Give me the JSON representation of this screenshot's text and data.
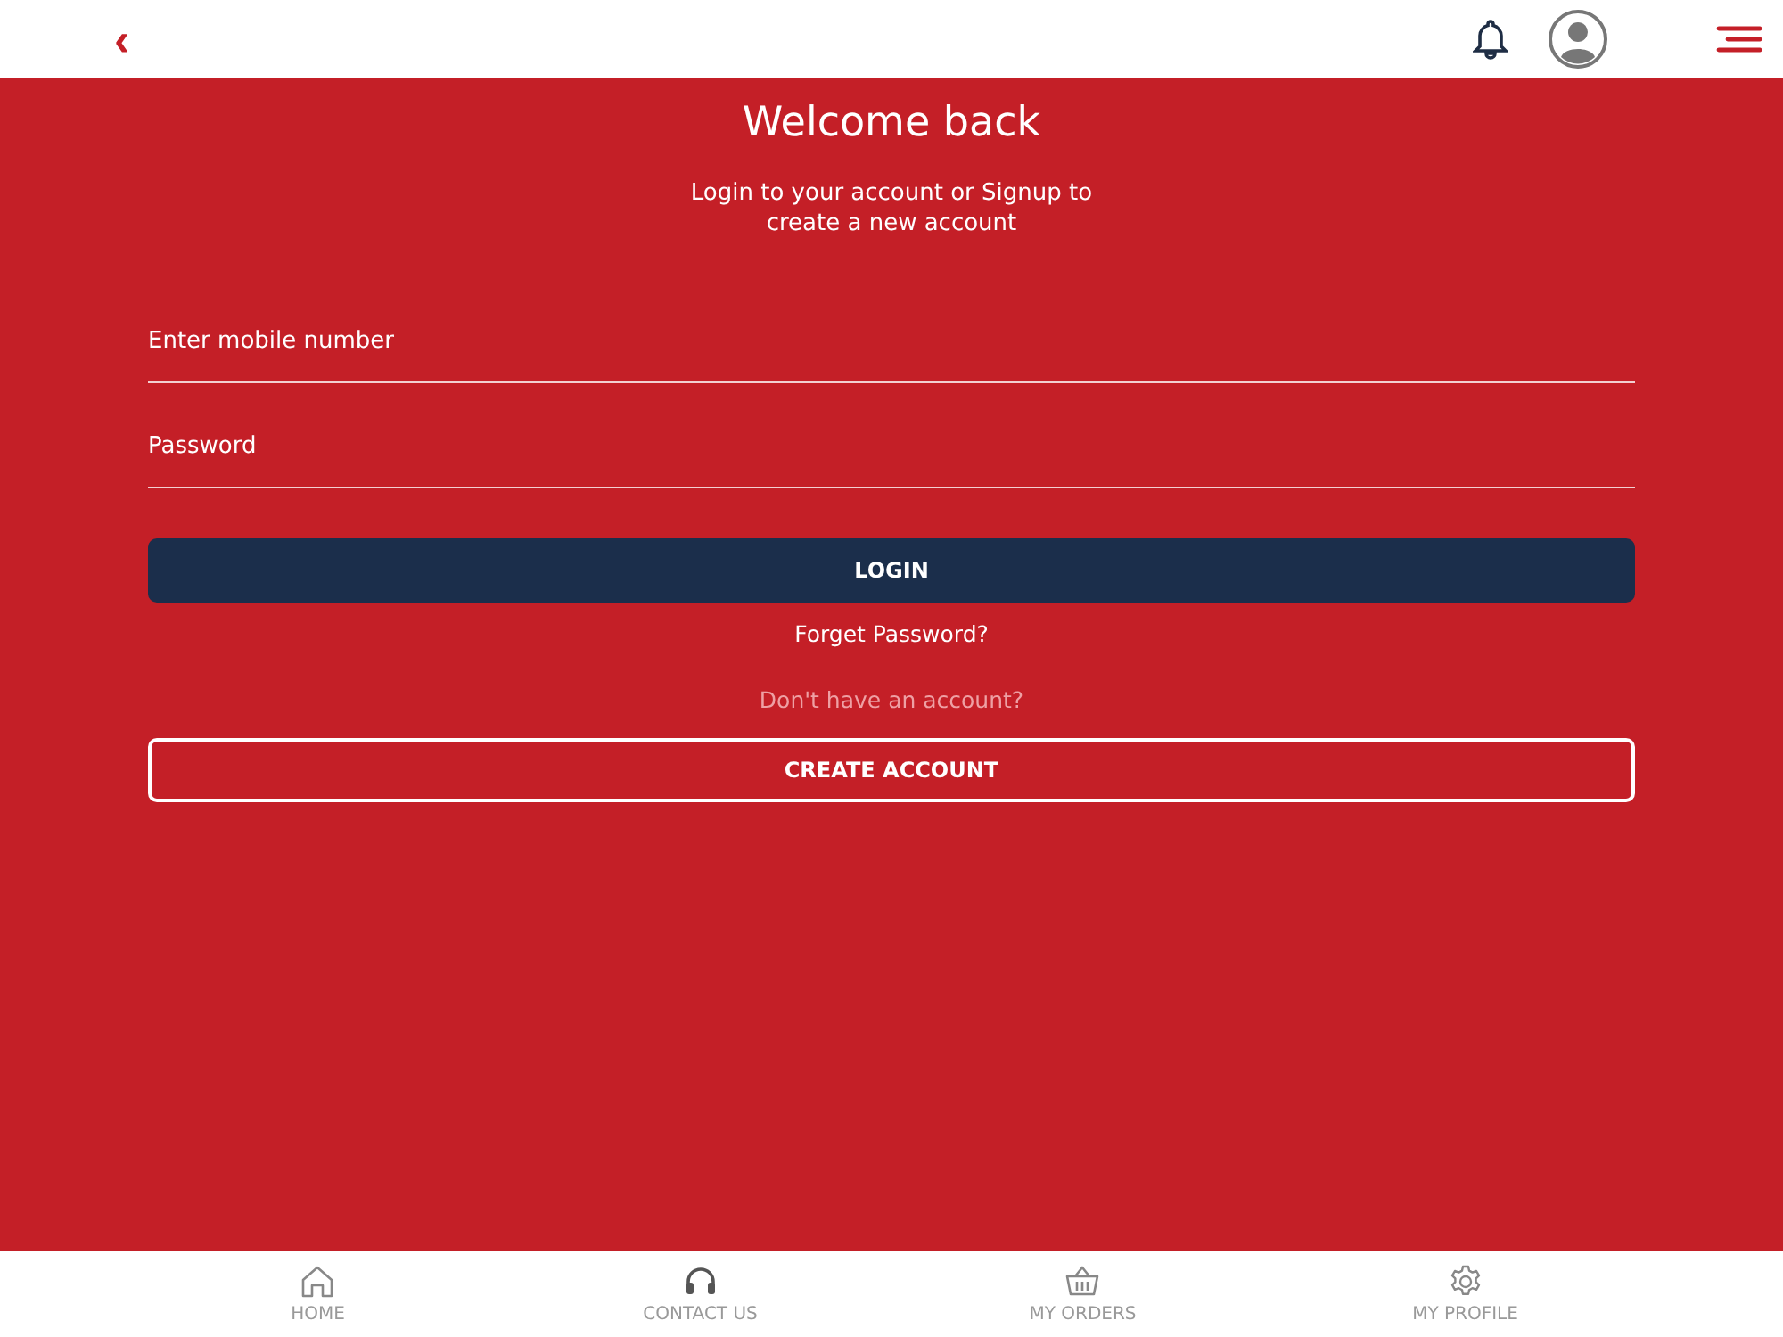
{
  "header": {
    "back": "‹"
  },
  "login": {
    "title": "Welcome back",
    "subtitle": "Login to your account or Signup to create a new account",
    "fields": [
      {
        "placeholder": "Enter mobile number"
      },
      {
        "placeholder": "Password"
      }
    ],
    "login_button": "LOGIN",
    "forgot_link": "Forget Password?",
    "signup_prompt": "Don't have an account?",
    "create_button": "CREATE ACCOUNT"
  },
  "tab_bar": [
    {
      "label": "HOME",
      "kind": "home"
    },
    {
      "label": "CONTACT US",
      "kind": "headset"
    },
    {
      "label": "MY ORDERS",
      "kind": "basket"
    },
    {
      "label": "MY PROFILE",
      "kind": "gear"
    }
  ]
}
